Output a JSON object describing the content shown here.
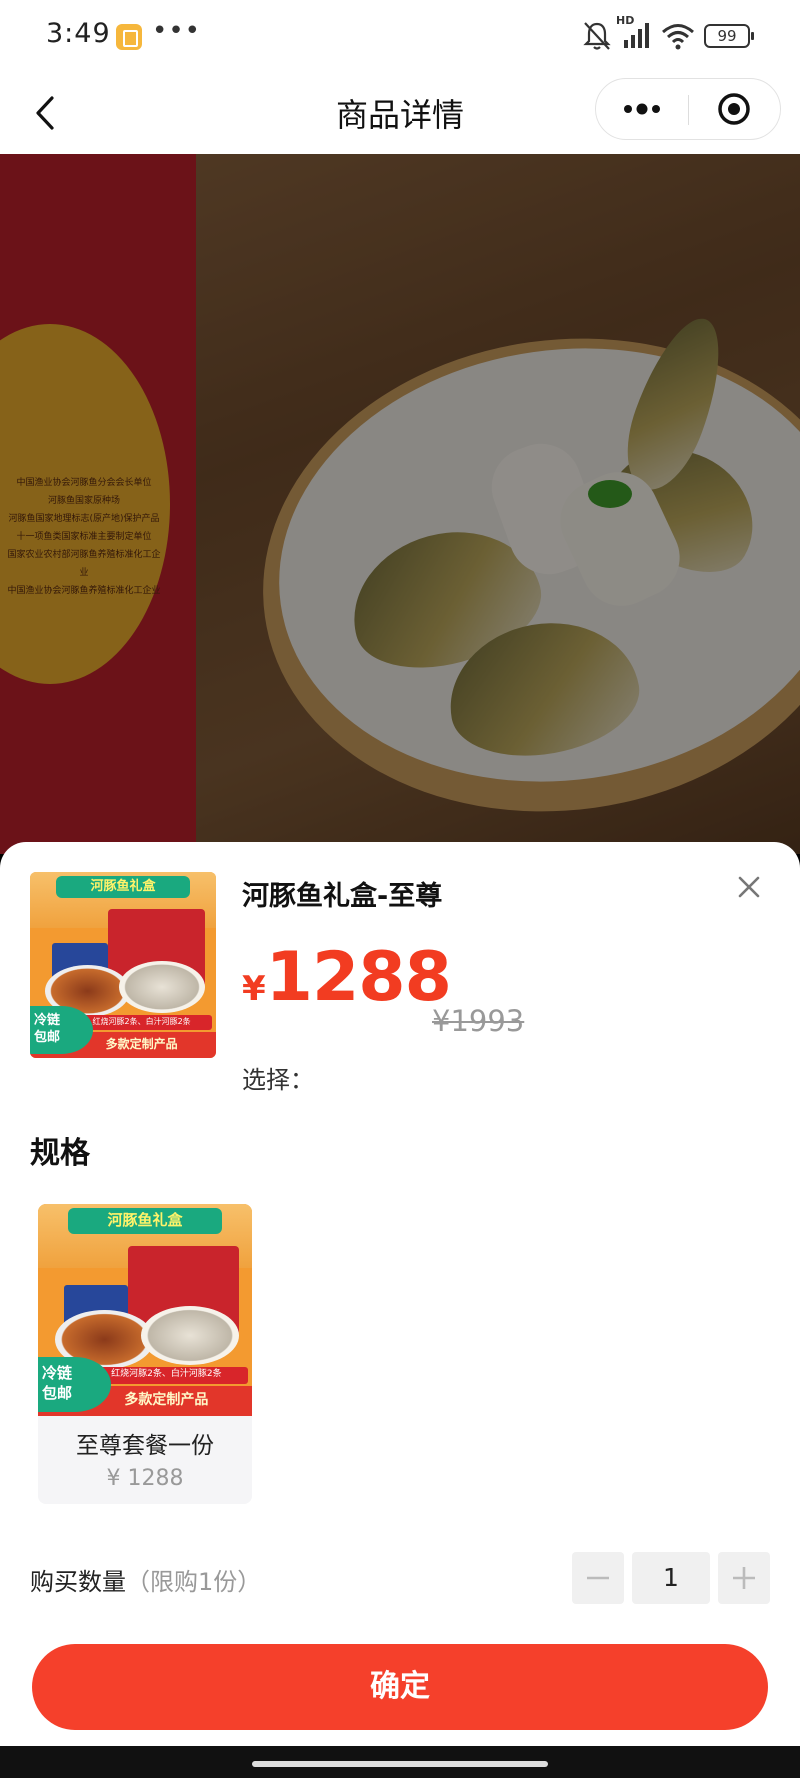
{
  "status_bar": {
    "time": "3:49",
    "more": "•••",
    "network": "HD",
    "battery": "99"
  },
  "nav": {
    "title": "商品详情"
  },
  "hero": {
    "box_text": "中国渔业协会河豚鱼分会会长单位\n河豚鱼国家原种场\n河豚鱼国家地理标志(原产地)保护产品\n十一项鱼类国家标准主要制定单位\n国家农业农村部河豚鱼养殖标准化工企业\n中国渔业协会河豚鱼养殖标准化工企业"
  },
  "sheet": {
    "product_name": "河豚鱼礼盒-至尊",
    "currency": "¥",
    "price": "1288",
    "original_price": "¥1993",
    "select_label": "选择：",
    "spec_title": "规格",
    "spec_options": [
      {
        "name": "至尊套餐一份",
        "price": "¥ 1288"
      }
    ],
    "gift_image": {
      "banner": "河豚鱼礼盒",
      "badge_line1": "冷链",
      "badge_line2": "包邮",
      "sub_text": "红烧河豚2条、白汁河豚2条",
      "footer": "多款定制产品"
    },
    "quantity_label": "购买数量",
    "quantity_limit": "（限购1份）",
    "quantity_value": "1",
    "confirm_label": "确定"
  },
  "colors": {
    "accent": "#f5402b",
    "price": "#f23c21",
    "muted": "#999999"
  },
  "icons": {
    "back": "chevron-left-icon",
    "menu": "more-dots-icon",
    "close_capsule": "target-circle-icon",
    "close_sheet": "close-icon",
    "minus": "minus-icon",
    "plus": "plus-icon"
  }
}
